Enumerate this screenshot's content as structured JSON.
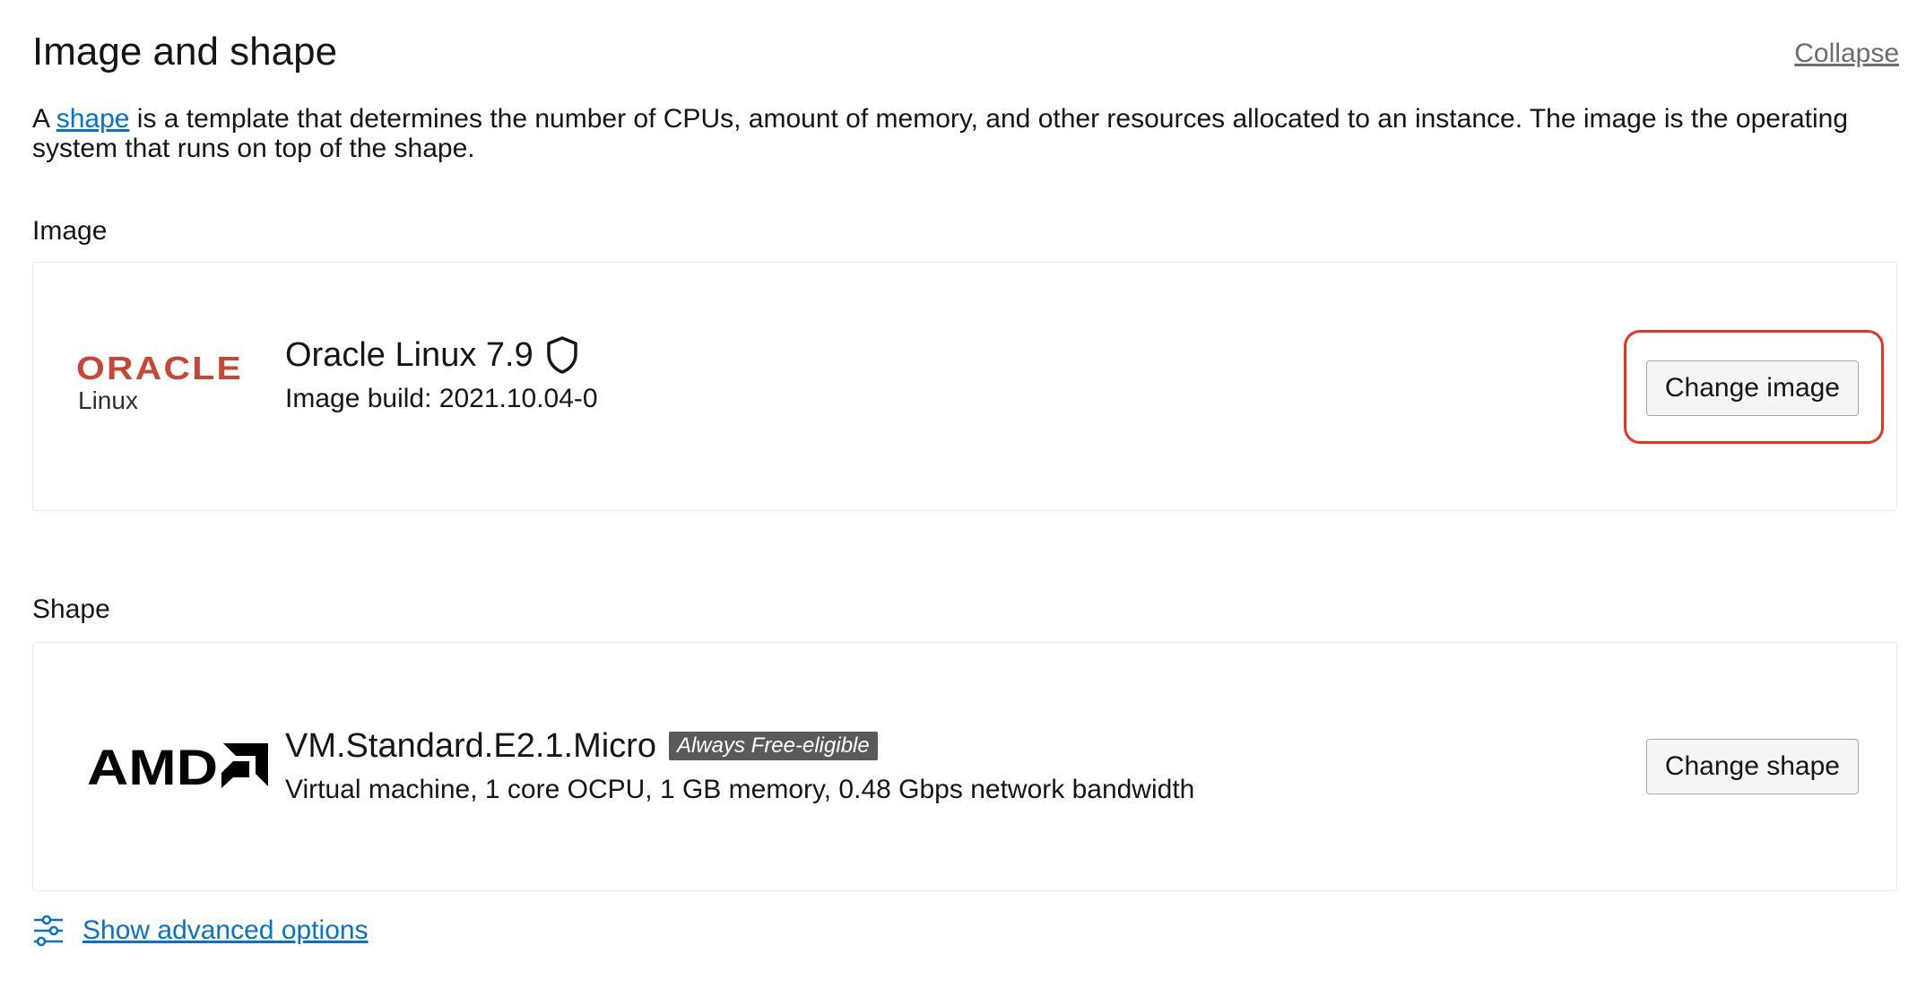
{
  "section": {
    "title": "Image and shape",
    "collapse_label": "Collapse",
    "description_prefix": "A ",
    "description_link": "shape",
    "description_suffix": " is a template that determines the number of CPUs, amount of memory, and other resources allocated to an instance. The image is the operating system that runs on top of the shape."
  },
  "image": {
    "label": "Image",
    "logo_wordmark": "ORACLE",
    "logo_sub": "Linux",
    "name": "Oracle Linux 7.9",
    "name_icon": "shield-icon",
    "build": "Image build: 2021.10.04-0",
    "button_label": "Change image"
  },
  "shape": {
    "label": "Shape",
    "logo_wordmark": "AMD",
    "name": "VM.Standard.E2.1.Micro",
    "badge": "Always Free-eligible",
    "details": "Virtual machine, 1 core OCPU, 1 GB memory, 0.48 Gbps network bandwidth",
    "button_label": "Change shape"
  },
  "advanced": {
    "icon": "sliders-icon",
    "label": "Show advanced options"
  },
  "colors": {
    "link": "#0572ce",
    "oracle_red": "#c74634",
    "highlight": "#e8321e",
    "badge_bg": "#5b5a58"
  }
}
